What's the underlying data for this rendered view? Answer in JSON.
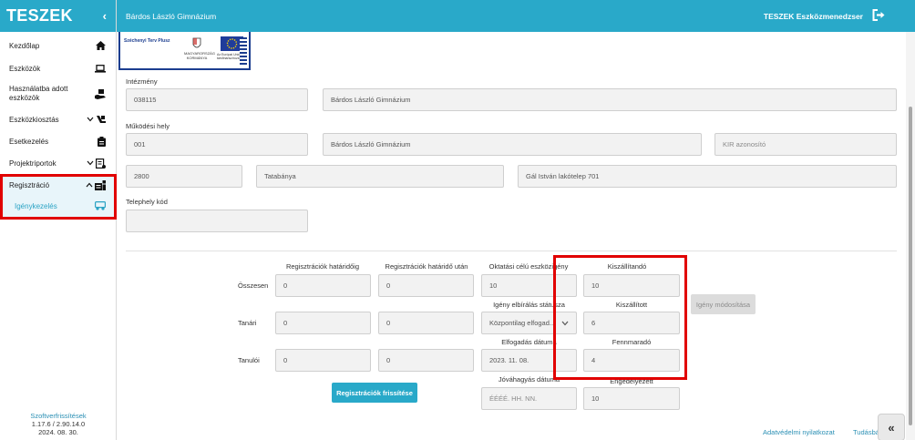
{
  "app": {
    "brand": "TESZEK",
    "collapse_icon": "chevron-left-icon"
  },
  "topbar": {
    "school": "Bárdos László Gimnázium",
    "system": "TESZEK Eszközmenedzser",
    "logout_icon": "logout-icon"
  },
  "sidebar": {
    "items": [
      {
        "label": "Kezdőlap",
        "icon": "home-icon"
      },
      {
        "label": "Eszközök",
        "icon": "laptop-icon"
      },
      {
        "label": "Használatba adott eszközök",
        "icon": "hand-device-icon"
      },
      {
        "label": "Eszközkiosztás",
        "icon": "distribution-icon"
      },
      {
        "label": "Esetkezelés",
        "icon": "clipboard-icon"
      },
      {
        "label": "Projektriportok",
        "icon": "report-icon"
      },
      {
        "label": "Regisztráció",
        "icon": "registration-icon"
      }
    ],
    "sub_items": [
      {
        "label": "Igénykezelés",
        "icon": "request-icon"
      }
    ],
    "footer": {
      "updates_link": "Szoftverfrissítések",
      "version": "1.17.6 / 2.90.14.0",
      "date": "2024. 08. 30."
    }
  },
  "logos": {
    "szechenyi": "Széchenyi Terv Plusz",
    "government": "MAGYARORSZÁG KORMÁNYA",
    "eu": "Az Európai Unió társfinanszírozásával"
  },
  "institution": {
    "label": "Intézmény",
    "code": "038115",
    "name": "Bárdos László Gimnázium"
  },
  "site": {
    "label": "Működési hely",
    "code": "001",
    "name": "Bárdos László Gimnázium",
    "kir_placeholder": "KIR azonosító",
    "zip": "2800",
    "city": "Tatabánya",
    "address": "Gál István lakótelep 701"
  },
  "premises": {
    "label": "Telephely kód",
    "value": ""
  },
  "stats": {
    "headers": [
      "Regisztrációk határidőig",
      "Regisztrációk határidő után",
      "Oktatási célú eszközigény"
    ],
    "rows": [
      {
        "label": "Összesen",
        "before": "0",
        "after": "0",
        "demand": "10"
      },
      {
        "label": "Tanári",
        "before": "0",
        "after": "0"
      },
      {
        "label": "Tanulói",
        "before": "0",
        "after": "0"
      }
    ],
    "status_label": "Igény elbírálás státusza",
    "status_value": "Központilag elfogad...",
    "accept_date_label": "Elfogadás dátuma",
    "accept_date_value": "2023. 11. 08.",
    "approve_date_label": "Jóváhagyás dátuma",
    "approve_date_placeholder": "ÉÉÉÉ. HH. NN.",
    "to_deliver_label": "Kiszállítandó",
    "to_deliver_value": "10",
    "delivered_label": "Kiszállított",
    "delivered_value": "6",
    "remaining_label": "Fennmaradó",
    "remaining_value": "4",
    "approved_label": "Engedélyezett",
    "approved_value": "10",
    "refresh_button": "Regisztrációk frissítése",
    "modify_button": "Igény módosítása"
  },
  "footer": {
    "privacy": "Adatvédelmi nyilatkozat",
    "knowledge": "Tudásbá",
    "scroll_top_icon": "double-chevron-left-icon"
  }
}
